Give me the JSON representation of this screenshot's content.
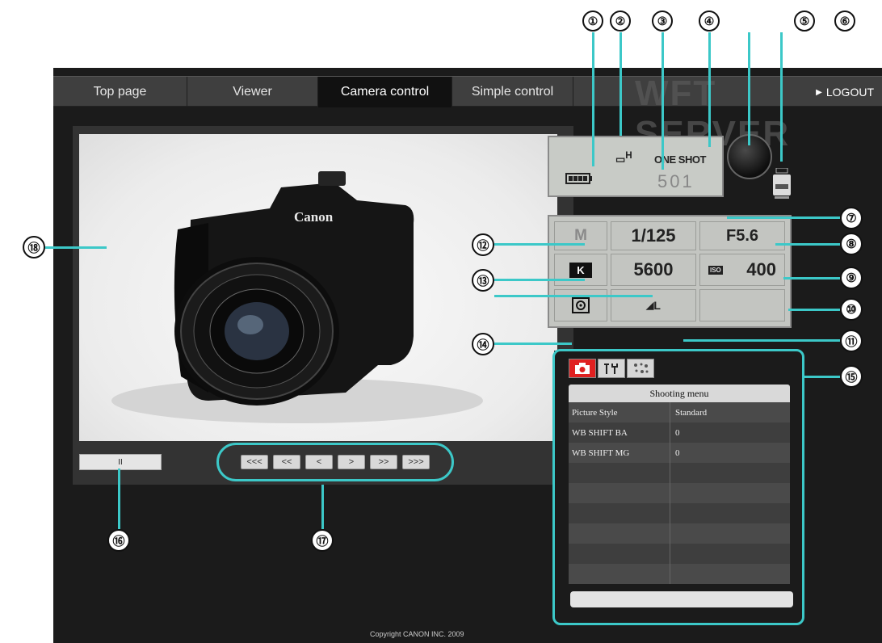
{
  "nav": {
    "tabs": [
      {
        "label": "Top page"
      },
      {
        "label": "Viewer"
      },
      {
        "label": "Camera control"
      },
      {
        "label": "Simple control"
      }
    ],
    "active_tab": "Camera control",
    "watermark": "WFT SERVER",
    "logout": "LOGOUT"
  },
  "callouts": [
    "①",
    "②",
    "③",
    "④",
    "⑤",
    "⑥",
    "⑦",
    "⑧",
    "⑨",
    "⑩",
    "⑪",
    "⑫",
    "⑬",
    "⑭",
    "⑮",
    "⑯",
    "⑰",
    "⑱"
  ],
  "live_view": {
    "camera_brand": "Canon"
  },
  "viewer": {
    "progress_label": "II",
    "nav_buttons": [
      "<<<",
      "<<",
      "<",
      ">",
      ">>",
      ">>>"
    ]
  },
  "lcd": {
    "battery_icon": "battery-icon",
    "drive_mode": "H",
    "af_mode": "ONE SHOT",
    "shots_remaining": "501"
  },
  "settings": {
    "mode": "M",
    "shutter": "1/125",
    "aperture": "F5.6",
    "wb_label": "K",
    "wb_value": "5600",
    "iso_label": "ISO",
    "iso": "400",
    "metering_icon": "metering-icon",
    "quality": "L"
  },
  "menu": {
    "tabs": [
      "camera-icon",
      "tools-icon",
      "my-menu-icon"
    ],
    "header": "Shooting menu",
    "rows": [
      {
        "name": "Picture Style",
        "value": "Standard"
      },
      {
        "name": "WB SHIFT BA",
        "value": "0"
      },
      {
        "name": "WB SHIFT MG",
        "value": "0"
      },
      {
        "name": "",
        "value": ""
      },
      {
        "name": "",
        "value": ""
      },
      {
        "name": "",
        "value": ""
      },
      {
        "name": "",
        "value": ""
      },
      {
        "name": "",
        "value": ""
      },
      {
        "name": "",
        "value": ""
      }
    ]
  },
  "copyright": "Copyright CANON INC. 2009",
  "colors": {
    "highlight": "#3cc8c8",
    "menu_tab_active": "#e02020"
  }
}
